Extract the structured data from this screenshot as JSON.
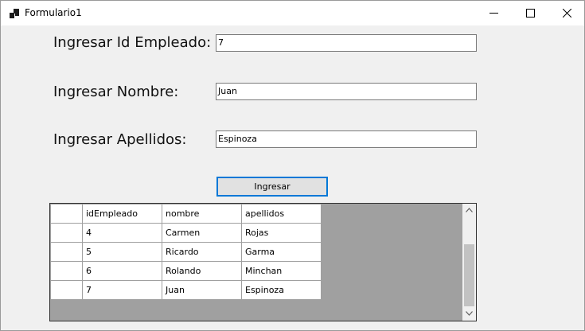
{
  "window": {
    "title": "Formulario1"
  },
  "form": {
    "id_label": "Ingresar Id Empleado:",
    "id_value": "7",
    "nombre_label": "Ingresar Nombre:",
    "nombre_value": "Juan",
    "apellidos_label": "Ingresar Apellidos:",
    "apellidos_value": "Espinoza",
    "submit_label": "Ingresar"
  },
  "table": {
    "columns": [
      "idEmpleado",
      "nombre",
      "apellidos"
    ],
    "rows": [
      [
        "4",
        "Carmen",
        "Rojas"
      ],
      [
        "5",
        "Ricardo",
        "Garma"
      ],
      [
        "6",
        "Rolando",
        "Minchan"
      ],
      [
        "7",
        "Juan",
        "Espinoza"
      ]
    ]
  },
  "icons": {
    "app": "app-window-icon",
    "minimize": "minimize-icon",
    "maximize": "maximize-icon",
    "close": "close-icon",
    "scroll_up": "chevron-up-icon",
    "scroll_down": "chevron-down-icon"
  },
  "colors": {
    "accent": "#0078d7",
    "grid_background": "#a0a0a0"
  }
}
